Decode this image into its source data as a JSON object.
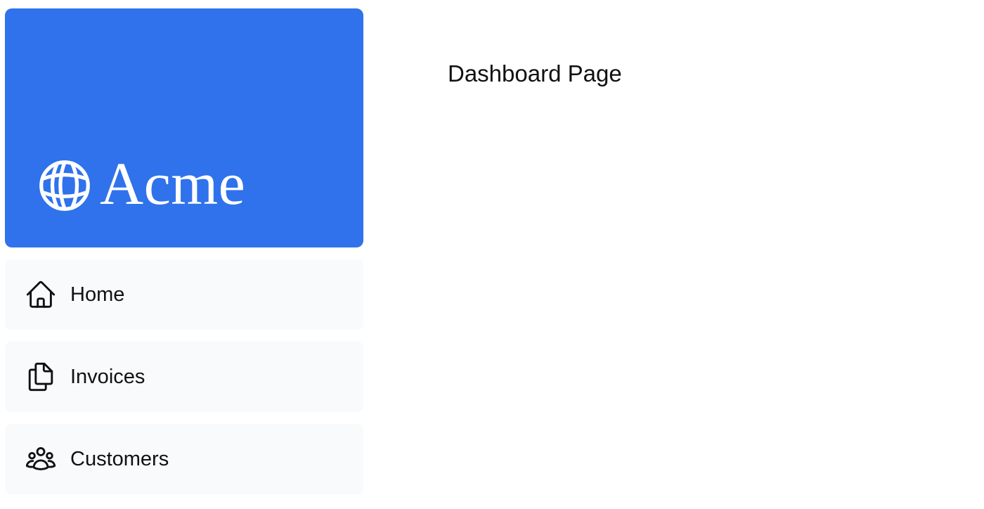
{
  "sidebar": {
    "brand": {
      "name": "Acme",
      "icon": "globe-icon",
      "background": "#2f72eb"
    },
    "items": [
      {
        "label": "Home",
        "icon": "home-icon"
      },
      {
        "label": "Invoices",
        "icon": "document-duplicate-icon"
      },
      {
        "label": "Customers",
        "icon": "user-group-icon"
      }
    ]
  },
  "main": {
    "title": "Dashboard Page"
  }
}
